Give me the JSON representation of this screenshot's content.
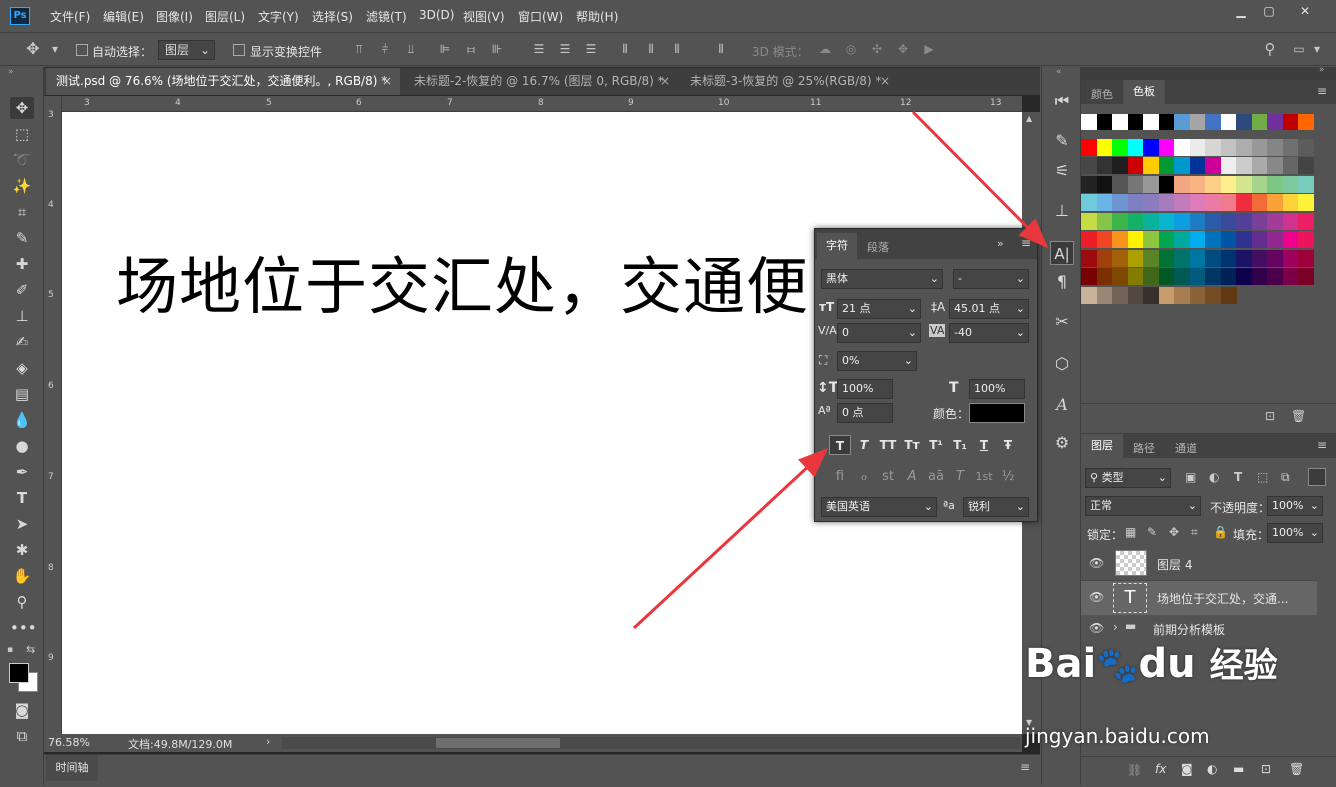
{
  "app": {
    "logo": "Ps"
  },
  "menu": [
    "文件(F)",
    "编辑(E)",
    "图像(I)",
    "图层(L)",
    "文字(Y)",
    "选择(S)",
    "滤镜(T)",
    "3D(D)",
    "视图(V)",
    "窗口(W)",
    "帮助(H)"
  ],
  "window_controls": {
    "minimize": "▁",
    "restore": "▢",
    "close": "✕"
  },
  "options": {
    "auto_select_label": "自动选择：",
    "auto_select_value": "图层",
    "show_transform_label": "显示变换控件",
    "mode_3d_label": "3D 模式："
  },
  "tabs": [
    {
      "label": "测试.psd @ 76.6% (场地位于交汇处，交通便利。, RGB/8) *",
      "close": "×"
    },
    {
      "label": "未标题-2-恢复的 @ 16.7% (图层 0, RGB/8) *",
      "close": "×"
    },
    {
      "label": "未标题-3-恢复的 @ 25%(RGB/8) *",
      "close": "×"
    }
  ],
  "ruler_top": [
    "3",
    "4",
    "5",
    "6",
    "7",
    "8",
    "9",
    "10",
    "11",
    "12",
    "13"
  ],
  "ruler_left": [
    "3",
    "4",
    "5",
    "6",
    "7",
    "8",
    "9"
  ],
  "canvas": {
    "text": "场地位于交汇处，交通便"
  },
  "status": {
    "zoom": "76.58%",
    "doc": "文档:49.8M/129.0M"
  },
  "timeline": {
    "label": "时间轴"
  },
  "char_panel": {
    "tab_char": "字符",
    "tab_para": "段落",
    "font_family": "黑体",
    "font_style": "-",
    "font_size": "21 点",
    "leading": "45.01 点",
    "kerning": "0",
    "tracking": "-40",
    "tsume": "0%",
    "vertical_scale": "100%",
    "horizontal_scale": "100%",
    "baseline_shift": "0 点",
    "color_label": "颜色：",
    "color": "#000000",
    "language": "美国英语",
    "aa_label": "ªa",
    "antialias": "锐利",
    "style_buttons": [
      "T",
      "T",
      "TT",
      "Tт",
      "T¹",
      "T₁",
      "T",
      "Ŧ"
    ],
    "ot_buttons": [
      "ﬁ",
      "ℴ",
      "st",
      "A",
      "aā",
      "T",
      "1st",
      "½"
    ]
  },
  "swatch_panel": {
    "tab_color": "颜色",
    "tab_swatch": "色板"
  },
  "layers_panel": {
    "tabs": [
      "图层",
      "路径",
      "通道"
    ],
    "filter_kind": "类型",
    "blend_mode": "正常",
    "opacity_label": "不透明度：",
    "opacity": "100%",
    "lock_label": "锁定：",
    "fill_label": "填充：",
    "fill": "100%",
    "layers": [
      {
        "name": "图层 4",
        "type": "pixel"
      },
      {
        "name": "场地位于交汇处，交通...",
        "type": "text"
      },
      {
        "name": "前期分析模板",
        "type": "group"
      }
    ],
    "fx_label": "fx"
  },
  "watermark": {
    "brand": "Bai",
    "brand2": "du",
    "product": "经验",
    "url": "jingyan.baidu.com"
  }
}
